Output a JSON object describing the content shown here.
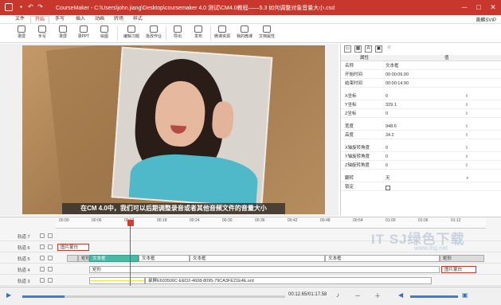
{
  "window": {
    "title": "CourseMaker - C:\\Users\\john.jiang\\Desktop\\coursemaker 4.0 测试\\CM4.0教程——5.3 如何调整对象音量大小.csd",
    "controls": [
      "─",
      "□",
      "✕"
    ]
  },
  "menu": {
    "items": [
      "文件",
      "开始",
      "手写",
      "插入",
      "动画",
      "转场",
      "样式"
    ],
    "active": "开始",
    "user": "黄麟SVIP"
  },
  "ribbon": {
    "buttons": [
      "录屏",
      "手写",
      "录屏",
      "录PPT",
      "绘图",
      "编辑习题",
      "批改作业",
      "导出",
      "发布",
      "微课资源",
      "我的微课",
      "文档属性"
    ]
  },
  "stage": {
    "subtitle": "在CM 4.0中，我们可以后期调整录音或者其他音频文件的音量大小"
  },
  "properties": {
    "header": {
      "name_col": "属性",
      "value_col": "值"
    },
    "rows": [
      {
        "key": "名称",
        "value": "文本框"
      },
      {
        "key": "开始时间",
        "value": "00:00:06.00"
      },
      {
        "key": "结束时间",
        "value": "00:00:14.90"
      },
      {
        "key": "X坐标",
        "value": "0"
      },
      {
        "key": "Y坐标",
        "value": "329.1"
      },
      {
        "key": "Z坐标",
        "value": "0"
      },
      {
        "key": "宽度",
        "value": "948.6"
      },
      {
        "key": "高度",
        "value": "34.2"
      },
      {
        "key": "X轴旋转角度",
        "value": "0"
      },
      {
        "key": "Y轴旋转角度",
        "value": "0"
      },
      {
        "key": "Z轴旋转角度",
        "value": "0"
      },
      {
        "key": "翻转",
        "value": "无"
      },
      {
        "key": "锁定",
        "value": ""
      }
    ]
  },
  "timeline": {
    "ticks": [
      "00:00",
      "00:06",
      "00:12",
      "00:18",
      "00:24",
      "00:30",
      "00:36",
      "00:42",
      "00:48",
      "00:54",
      "01:00",
      "01:06",
      "01:12"
    ],
    "playhead_time": "00:12",
    "tracks": [
      {
        "name": "轨道 7"
      },
      {
        "name": "轨道 6"
      },
      {
        "name": "轨道 5"
      },
      {
        "name": "轨道 4"
      },
      {
        "name": "轨道 3"
      }
    ],
    "clips": {
      "image1": "图片蒙白",
      "rect_label": "矩形",
      "text_label": "文本框",
      "rect2": "矩形",
      "image2": "图片蒙白",
      "audio_file": "录屏E603506C-EED2-4608-8095-79CA3FE21E4E.srd"
    }
  },
  "transport": {
    "timecode": "00:12.65/01:17.58",
    "progress": 0.16
  },
  "watermark": {
    "text": "IT SJ绿色下载",
    "url": "www.itsj.net"
  }
}
